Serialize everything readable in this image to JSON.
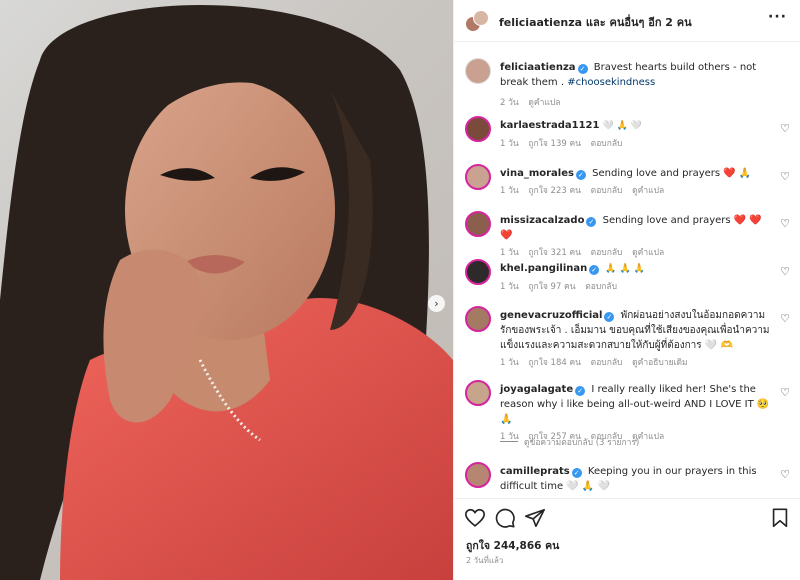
{
  "colors": {
    "accent": "#3897f0",
    "border": "#efefef",
    "secondary": "#8e8e8e",
    "red_top": "#e8584f"
  },
  "header": {
    "title": "feliciaatienza และ คนอื่นๆ อีก 2 คน",
    "more_icon": "more-horizontal-icon"
  },
  "caption": {
    "username": "feliciaatienza",
    "text": "Bravest hearts build others - not break them .",
    "hashtag": "#choosekindness",
    "time": "2 วัน",
    "translate": "ดูคำแปล"
  },
  "comments": [
    {
      "username": "karlaestrada1121",
      "verified": false,
      "text": "🤍 🙏 🤍",
      "time": "1 วัน",
      "likes": "ถูกใจ 139 คน",
      "reply": "ตอบกลับ",
      "extra": ""
    },
    {
      "username": "vina_morales",
      "verified": true,
      "text": "Sending love and prayers ❤️ 🙏",
      "time": "1 วัน",
      "likes": "ถูกใจ 223 คน",
      "reply": "ตอบกลับ",
      "extra": "ดูคำแปล"
    },
    {
      "username": "missizacalzado",
      "verified": true,
      "text": "Sending love and prayers ❤️ ❤️ ❤️",
      "time": "1 วัน",
      "likes": "ถูกใจ 321 คน",
      "reply": "ตอบกลับ",
      "extra": "ดูคำแปล"
    },
    {
      "username": "khel.pangilinan",
      "verified": true,
      "text": "🙏 🙏 🙏",
      "time": "1 วัน",
      "likes": "ถูกใจ 97 คน",
      "reply": "ตอบกลับ",
      "extra": ""
    },
    {
      "username": "genevacruzofficial",
      "verified": true,
      "text": "พักผ่อนอย่างสงบในอ้อมกอดความรักของพระเจ้า . เอ็มมาน ขอบคุณที่ใช้เสียงของคุณเพื่อนำความแข็งแรงและความสะดวกสบายให้กับผู้ที่ต้องการ 🤍 🫶",
      "time": "1 วัน",
      "likes": "ถูกใจ 184 คน",
      "reply": "ตอบกลับ",
      "extra": "ดูคำอธิบายเดิม"
    },
    {
      "username": "joyagalagate",
      "verified": true,
      "text": "I really really liked her! She's the reason why i like being all-out-weird AND I LOVE IT 🥺 🙏",
      "time": "1 วัน",
      "likes": "ถูกใจ 257 คน",
      "reply": "ตอบกลับ",
      "extra": "ดูคำแปล"
    },
    {
      "username": "camilleprats",
      "verified": true,
      "text": "Keeping you in our prayers in this difficult time 🤍 🙏 🤍",
      "time": "",
      "likes": "",
      "reply": "",
      "extra": ""
    }
  ],
  "view_replies": "ดูข้อความตอบกลับ (3 รายการ)",
  "actions": {
    "like_icon": "heart-icon",
    "comment_icon": "comment-icon",
    "share_icon": "send-icon",
    "save_icon": "bookmark-icon"
  },
  "likes_count": "ถูกใจ 244,866 คน",
  "posted_ago": "2 วันที่แล้ว"
}
